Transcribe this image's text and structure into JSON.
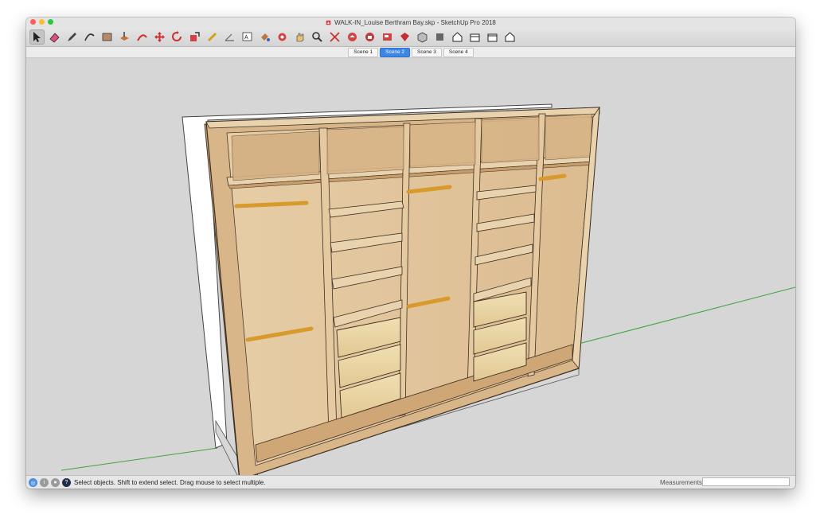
{
  "window": {
    "title": "WALK-IN_Louise Berthram Bay.skp - SketchUp Pro 2018",
    "traffic_lights": [
      "#fe5f57",
      "#febc2e",
      "#28c840"
    ]
  },
  "toolbar": {
    "tools": [
      {
        "name": "select-tool",
        "icon": "arrow-icon"
      },
      {
        "name": "eraser-tool",
        "icon": "eraser-icon"
      },
      {
        "name": "line-tool",
        "icon": "pencil-icon"
      },
      {
        "name": "arc-tool",
        "icon": "arc-icon"
      },
      {
        "name": "shape-tool",
        "icon": "rectangle-icon"
      },
      {
        "name": "push-pull-tool",
        "icon": "push-pull-icon"
      },
      {
        "name": "offset-tool",
        "icon": "offset-icon"
      },
      {
        "name": "move-tool",
        "icon": "move-icon"
      },
      {
        "name": "rotate-tool",
        "icon": "rotate-icon"
      },
      {
        "name": "scale-tool",
        "icon": "scale-icon"
      },
      {
        "name": "tape-measure-tool",
        "icon": "tape-icon"
      },
      {
        "name": "protractor-tool",
        "icon": "protractor-icon"
      },
      {
        "name": "text-tool",
        "icon": "text-icon"
      },
      {
        "name": "paint-bucket-tool",
        "icon": "paint-icon"
      },
      {
        "name": "orbit-tool",
        "icon": "orbit-icon"
      },
      {
        "name": "pan-tool",
        "icon": "hand-icon"
      },
      {
        "name": "zoom-tool",
        "icon": "zoom-icon"
      },
      {
        "name": "zoom-extents-tool",
        "icon": "zoom-extents-icon"
      },
      {
        "name": "warehouse-tool",
        "icon": "warehouse-icon"
      },
      {
        "name": "extension-warehouse-tool",
        "icon": "extension-icon"
      },
      {
        "name": "layout-tool",
        "icon": "layout-icon"
      },
      {
        "name": "extension-manager-tool",
        "icon": "ruby-icon"
      },
      {
        "name": "iso-view",
        "icon": "iso-icon"
      },
      {
        "name": "top-view",
        "icon": "top-view-icon"
      },
      {
        "name": "front-view",
        "icon": "front-view-icon"
      },
      {
        "name": "right-view",
        "icon": "right-view-icon"
      },
      {
        "name": "back-view",
        "icon": "back-view-icon"
      },
      {
        "name": "left-view",
        "icon": "left-view-icon"
      }
    ]
  },
  "scenes": [
    {
      "label": "Scene 1",
      "active": false
    },
    {
      "label": "Scene 2",
      "active": true
    },
    {
      "label": "Scene 3",
      "active": false
    },
    {
      "label": "Scene 4",
      "active": false
    }
  ],
  "status": {
    "hint": "Select objects. Shift to extend select. Drag mouse to select multiple.",
    "measurements_label": "Measurements",
    "measurements_value": ""
  },
  "colors": {
    "wood_light": "#e9d2ae",
    "wood_mid": "#d9b68a",
    "wood_dark": "#b98a59",
    "rod": "#d89a2c",
    "drawer": "#ead6a4",
    "green_axis": "#3ea33e",
    "accent_blue": "#3b86e6"
  }
}
